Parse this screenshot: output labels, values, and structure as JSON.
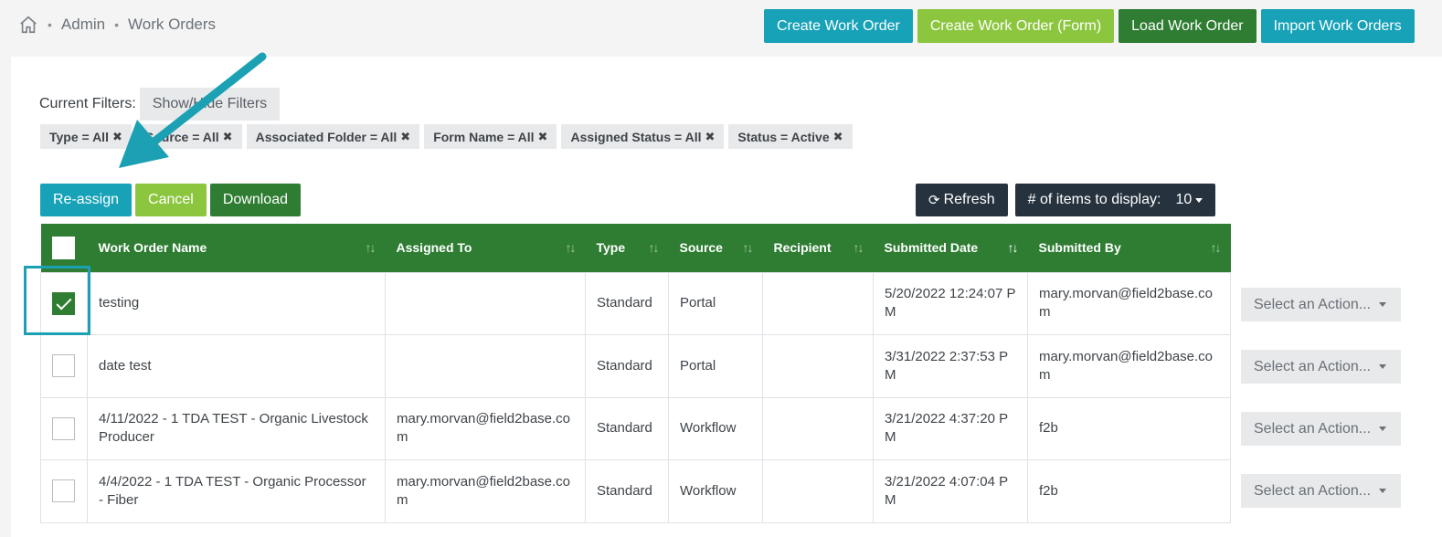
{
  "breadcrumb": {
    "home_icon": "home-icon",
    "items": [
      "Admin",
      "Work Orders"
    ]
  },
  "header_buttons": {
    "create": "Create Work Order",
    "create_form": "Create Work Order (Form)",
    "load": "Load Work Order",
    "import": "Import Work Orders"
  },
  "filters": {
    "label": "Current Filters:",
    "toggle_button": "Show/Hide Filters",
    "chips": [
      "Type = All",
      "Source = All",
      "Associated Folder = All",
      "Form Name = All",
      "Assigned Status = All",
      "Status = Active"
    ]
  },
  "actions": {
    "reassign": "Re-assign",
    "cancel": "Cancel",
    "download": "Download"
  },
  "toolbar": {
    "refresh": "Refresh",
    "items_label": "# of items to display:",
    "items_value": "10"
  },
  "table": {
    "columns": [
      "Work Order Name",
      "Assigned To",
      "Type",
      "Source",
      "Recipient",
      "Submitted Date",
      "Submitted By"
    ],
    "rows": [
      {
        "checked": true,
        "name": "testing",
        "assigned_to": "",
        "type": "Standard",
        "source": "Portal",
        "recipient": "",
        "submitted_date": "5/20/2022 12:24:07 PM",
        "submitted_by": "mary.morvan@field2base.com",
        "action": "Select an Action..."
      },
      {
        "checked": false,
        "name": "date test",
        "assigned_to": "",
        "type": "Standard",
        "source": "Portal",
        "recipient": "",
        "submitted_date": "3/31/2022 2:37:53 PM",
        "submitted_by": "mary.morvan@field2base.com",
        "action": "Select an Action..."
      },
      {
        "checked": false,
        "name": "4/11/2022 - 1 TDA TEST - Organic Livestock Producer",
        "assigned_to": "mary.morvan@field2base.com",
        "type": "Standard",
        "source": "Workflow",
        "recipient": "",
        "submitted_date": "3/21/2022 4:37:20 PM",
        "submitted_by": "f2b",
        "action": "Select an Action..."
      },
      {
        "checked": false,
        "name": "4/4/2022 - 1 TDA TEST - Organic Processor - Fiber",
        "assigned_to": "mary.morvan@field2base.com",
        "type": "Standard",
        "source": "Workflow",
        "recipient": "",
        "submitted_date": "3/21/2022 4:07:04 PM",
        "submitted_by": "f2b",
        "action": "Select an Action..."
      }
    ]
  },
  "colors": {
    "teal": "#17a2b8",
    "lime": "#8cc63f",
    "green": "#2e7d32",
    "navy": "#26333f",
    "annotation": "#1ba1b3"
  }
}
